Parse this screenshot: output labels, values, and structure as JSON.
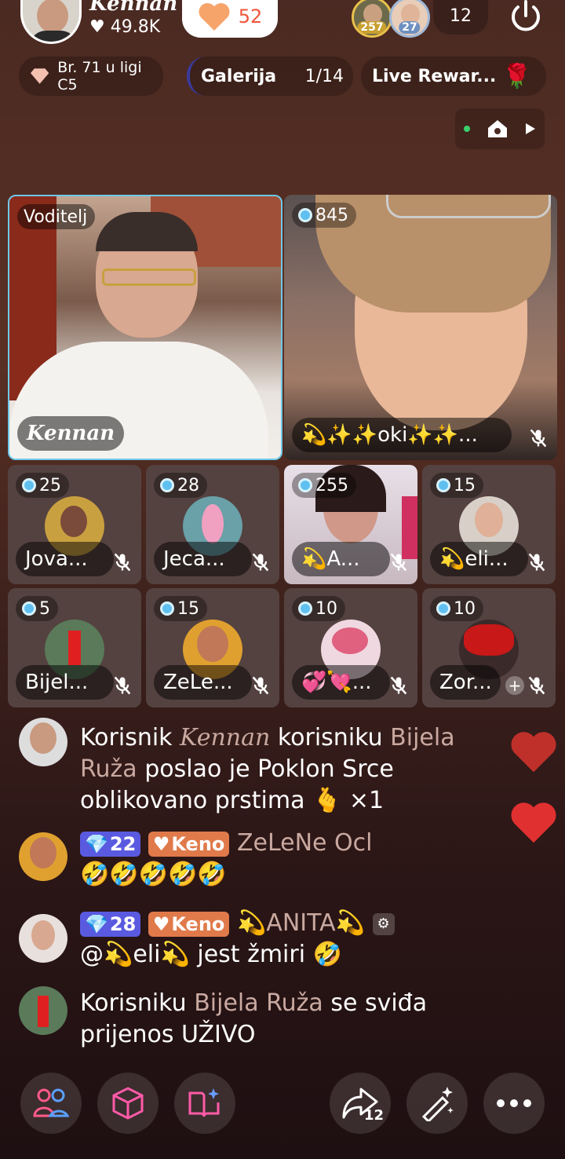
{
  "host": {
    "name": "Kennan",
    "likes": "49.8K"
  },
  "like_count": "52",
  "viewers": {
    "badge1": "257",
    "badge2": "27",
    "count": "12"
  },
  "rank": {
    "label": "Br. 71 u ligi C5"
  },
  "gallery": {
    "label": "Galerija",
    "page": "1/14"
  },
  "reward": {
    "label": "Live Rewar..."
  },
  "tiles": {
    "host": {
      "role": "Voditelj",
      "name": "Kennan"
    },
    "guest": {
      "count": "845",
      "name": "💫✨✨oki✨✨..."
    },
    "s1": {
      "count": "25",
      "name": "Jova..."
    },
    "s2": {
      "count": "28",
      "name": "Jeca..."
    },
    "s3": {
      "count": "255",
      "name": "💫A..."
    },
    "s4": {
      "count": "15",
      "name": "💫eli..."
    },
    "s5": {
      "count": "5",
      "name": "Bijel..."
    },
    "s6": {
      "count": "15",
      "name": "ZeLe..."
    },
    "s7": {
      "count": "10",
      "name": "💞💘..."
    },
    "s8": {
      "count": "10",
      "name": "Zor..."
    }
  },
  "chat": [
    {
      "p1": "Korisnik ",
      "user": "Kennan",
      "p2": " korisniku ",
      "to": "Bijela Ruža",
      "p3": " poslao je Poklon Srce oblikovano prstima 🫰 ×1"
    },
    {
      "level": "22",
      "fan": "Keno",
      "user": "ZeLeNe Ocl",
      "msg": "🤣🤣🤣🤣🤣"
    },
    {
      "level": "28",
      "fan": "Keno",
      "user": "💫ANITA💫",
      "msg": "@💫eli💫 jest žmiri 🤣"
    },
    {
      "p1": "Korisniku ",
      "user": "Bijela Ruža",
      "p2": " se sviđa prijenos UŽIVO"
    }
  ],
  "share_count": "12",
  "colors": {
    "accent_pink": "#f0553a",
    "level_badge": "#5a5ae0",
    "fan_badge": "#e07a4a",
    "tile_border": "#6ec8e8"
  }
}
